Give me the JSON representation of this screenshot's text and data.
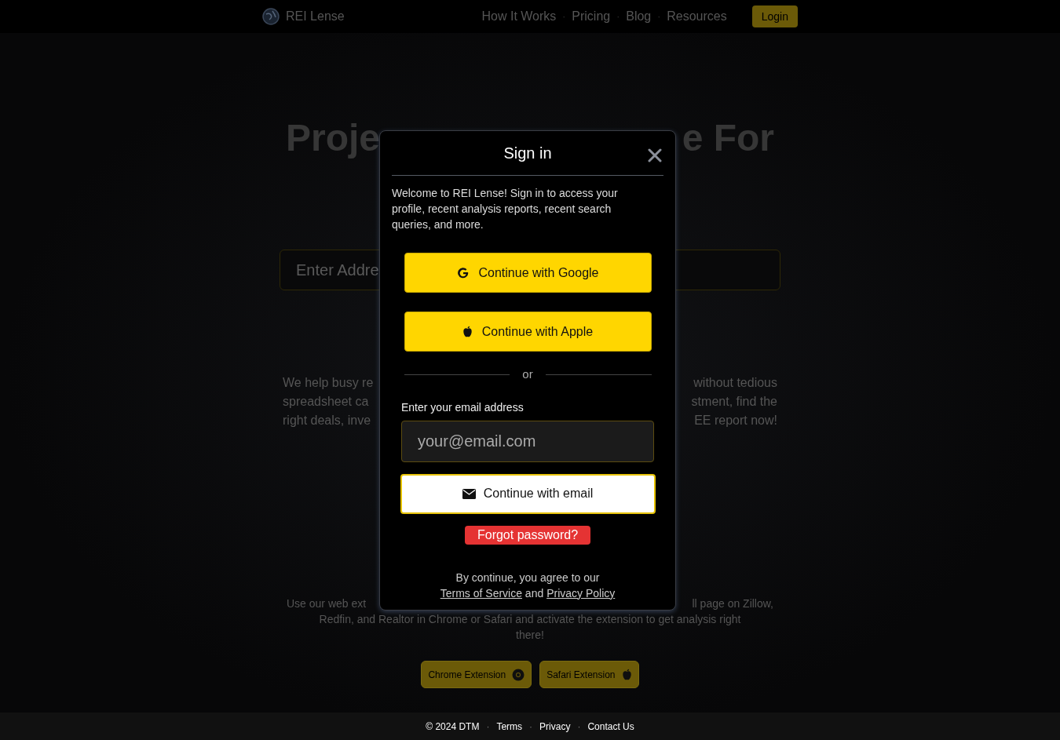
{
  "nav": {
    "brand": "REI Lense",
    "items": [
      {
        "kind": "link",
        "label": "How It Works"
      },
      {
        "kind": "separator",
        "label": "·"
      },
      {
        "kind": "link",
        "label": "Pricing"
      },
      {
        "kind": "separator",
        "label": "·"
      },
      {
        "kind": "link",
        "label": "Blog"
      },
      {
        "kind": "separator",
        "label": "·"
      },
      {
        "kind": "link",
        "label": "Resources"
      }
    ],
    "login": "Login"
  },
  "hero": {
    "headline_fragments": [
      "Proje",
      "e For"
    ],
    "address_field": {
      "placeholder": "Enter Addre"
    },
    "intro_lines": [
      {
        "left": "We help busy re",
        "right": "without tedious"
      },
      {
        "left": "spreadsheet ca",
        "right": "stment, find the"
      },
      {
        "left": "right deals, inve",
        "right": "EE report now!"
      }
    ]
  },
  "extension_section": {
    "lines": [
      {
        "left": "Use our web ext",
        "right": "ll page on Zillow,"
      },
      {
        "full": "Redfin, and Realtor in Chrome or Safari and activate the extension to get analysis right"
      },
      {
        "full": "there!"
      }
    ],
    "buttons": [
      {
        "kind": "chrome",
        "label": "Chrome Extension"
      },
      {
        "kind": "apple",
        "label": "Safari Extension"
      }
    ]
  },
  "modal": {
    "title": "Sign in",
    "intro": "Welcome to REI Lense! Sign in to access your profile, recent analysis reports, recent search queries, and more.",
    "providers": [
      {
        "kind": "google",
        "label": "Continue with Google"
      },
      {
        "kind": "apple",
        "label": "Continue with Apple"
      }
    ],
    "divider": "or",
    "email_label": "Enter your email address",
    "email_placeholder": "your@email.com",
    "email_button": "Continue with email",
    "forgot_button": "Forgot password?",
    "agreement": {
      "text": "By continue, you agree to our",
      "links": [
        "Terms of Service",
        "Privacy Policy"
      ],
      "joiner": "and"
    }
  },
  "footer": {
    "items": [
      {
        "kind": "text",
        "label": "© 2024 DTM"
      },
      {
        "kind": "separator",
        "label": "·"
      },
      {
        "kind": "link",
        "label": "Terms"
      },
      {
        "kind": "separator",
        "label": "·"
      },
      {
        "kind": "link",
        "label": "Privacy"
      },
      {
        "kind": "separator",
        "label": "·"
      },
      {
        "kind": "link",
        "label": "Contact Us"
      }
    ]
  }
}
